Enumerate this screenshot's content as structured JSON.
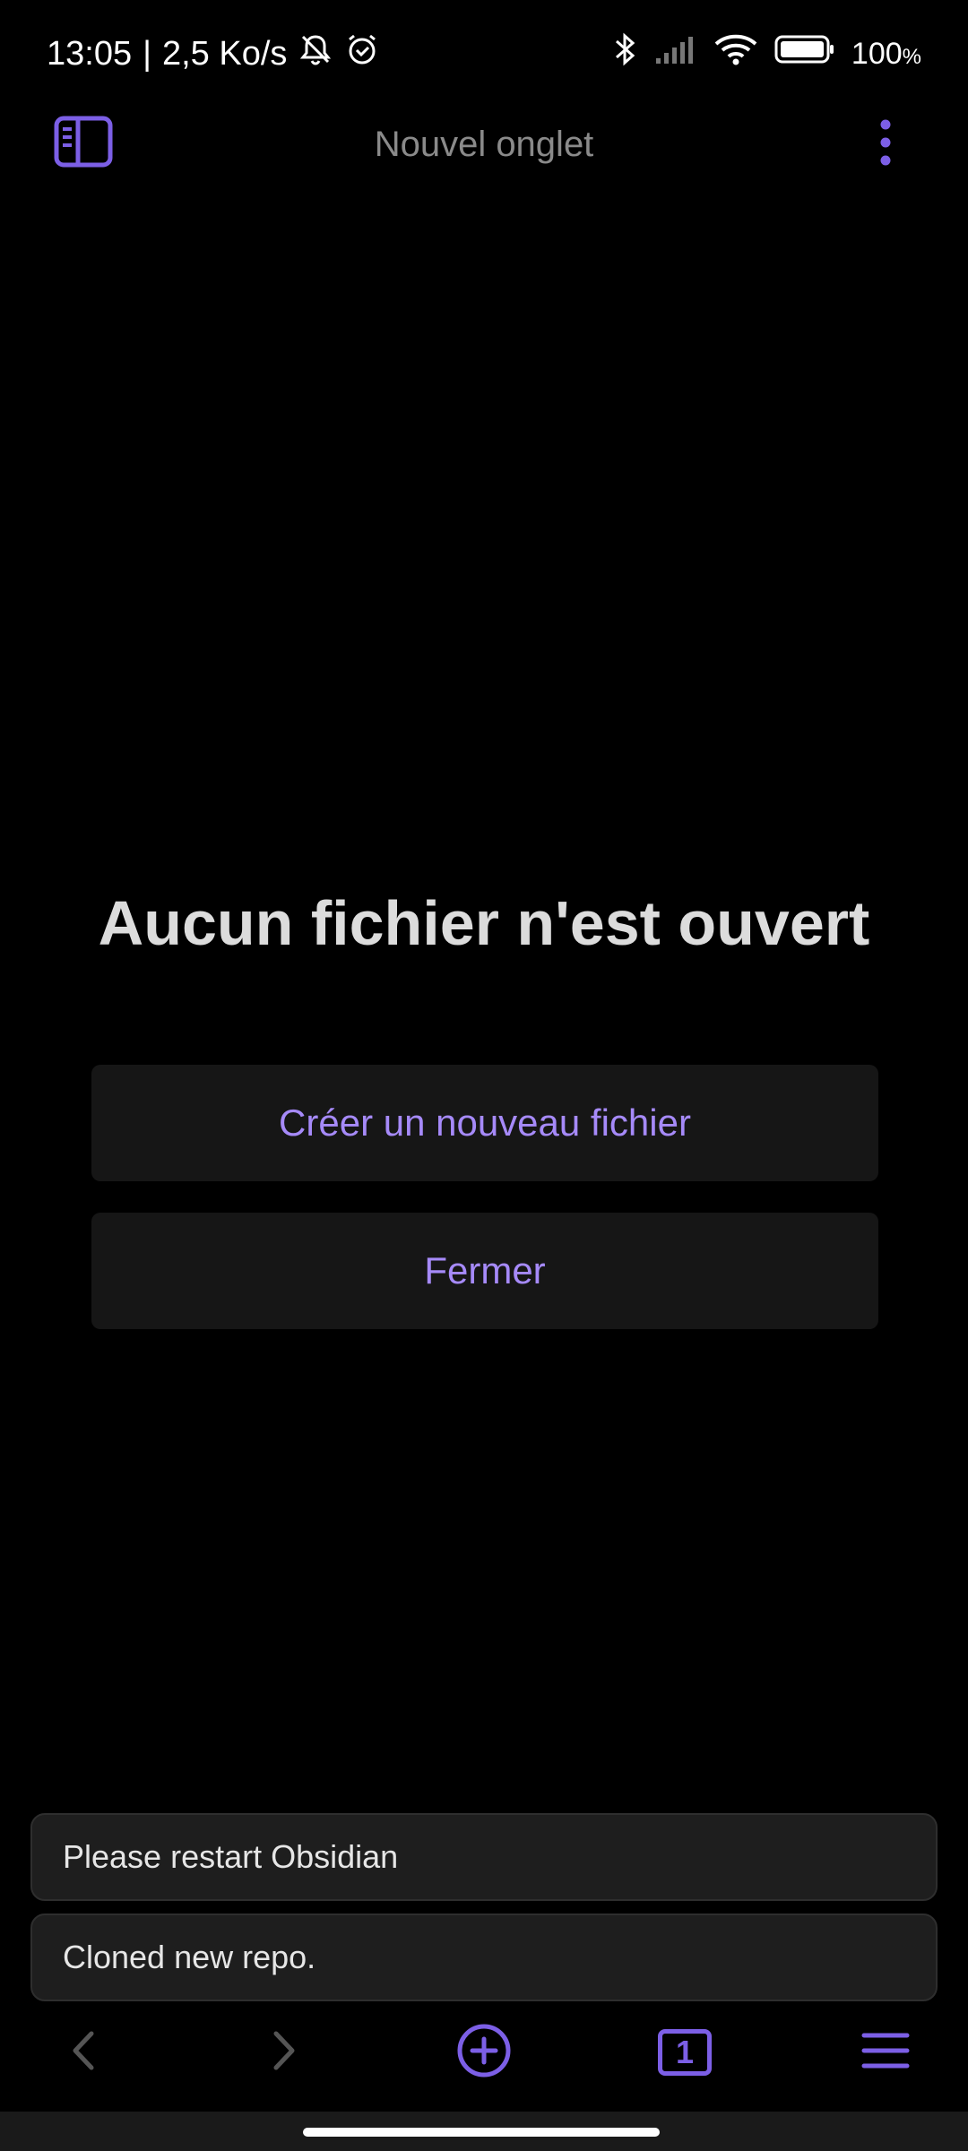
{
  "status_bar": {
    "time": "13:05",
    "separator": "|",
    "network_speed": "2,5 Ko/s",
    "battery_level": "100",
    "battery_unit": "%",
    "icons": [
      "mute-icon",
      "alarm-icon",
      "bluetooth-icon",
      "signal-icon",
      "wifi-icon",
      "battery-icon"
    ]
  },
  "top_bar": {
    "title": "Nouvel onglet",
    "left_icon": "sidebar-toggle-icon",
    "right_icon": "more-vertical-icon"
  },
  "empty_state": {
    "title": "Aucun fichier n'est ouvert",
    "create_label": "Créer un nouveau fichier",
    "close_label": "Fermer"
  },
  "notices": [
    {
      "text": "Please restart Obsidian"
    },
    {
      "text": "Cloned new repo."
    }
  ],
  "bottom_nav": {
    "icons": [
      "back-icon",
      "forward-icon",
      "new-tab-icon",
      "tab-switcher-icon",
      "menu-icon"
    ],
    "tab_count": "1"
  },
  "colors": {
    "background": "#000000",
    "accent": "#7c5fe6",
    "button_text": "#a68af9",
    "button_bg": "#161616",
    "notice_bg": "#1e1e1e"
  }
}
